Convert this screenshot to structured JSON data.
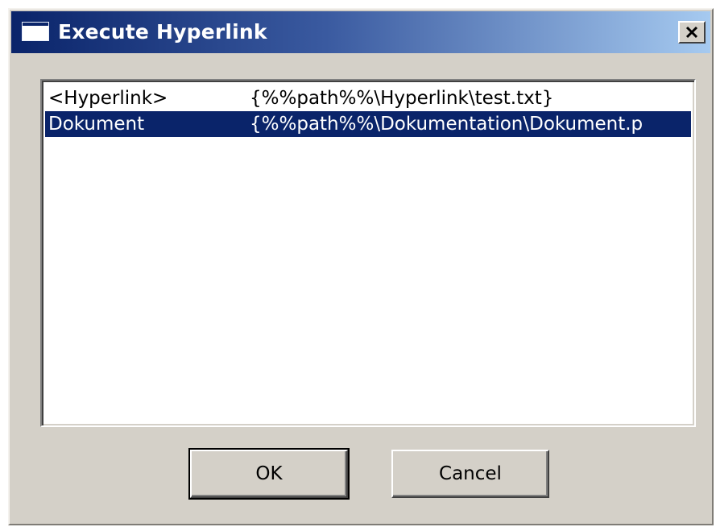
{
  "window": {
    "title": "Execute Hyperlink",
    "close_glyph": "×"
  },
  "hyperlink_list": {
    "rows": [
      {
        "name": "<Hyperlink>",
        "path": "{%%path%%\\Hyperlink\\test.txt}",
        "selected": false
      },
      {
        "name": "Dokument",
        "path": "{%%path%%\\Dokumentation\\Dokument.p",
        "selected": true
      }
    ]
  },
  "buttons": {
    "ok_label": "OK",
    "cancel_label": "Cancel"
  },
  "colors": {
    "dialog_face": "#d4d0c8",
    "title_gradient_start": "#0a246a",
    "title_gradient_end": "#a6caf0",
    "selection": "#0a246a"
  },
  "icons": {
    "window": "window-icon",
    "close": "close-icon"
  }
}
